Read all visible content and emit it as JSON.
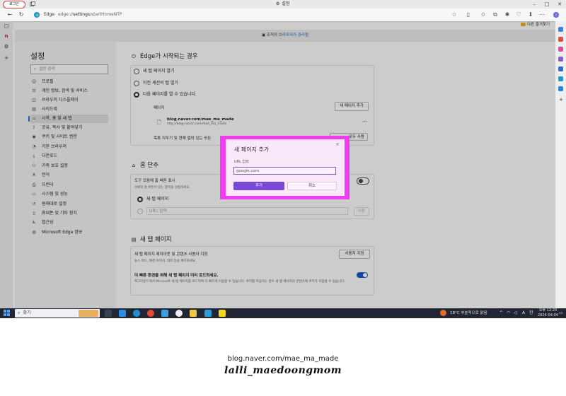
{
  "tabbar": {
    "profile_label": "로그인",
    "tab_title": "설정"
  },
  "addressbar": {
    "edge_label": "Edge",
    "url_prefix": "edge://",
    "url_highlight": "settings",
    "url_suffix": "/startHomeNTP"
  },
  "favorites": {
    "folder_label": "다른 즐겨찾기"
  },
  "banner": {
    "text": "조직의",
    "link": "브라우저가 관리됨"
  },
  "sidebar": {
    "title": "설정",
    "search_placeholder": "설정 검색",
    "items": [
      {
        "label": "프로필",
        "icon": "profile-icon"
      },
      {
        "label": "개인 정보, 검색 및 서비스",
        "icon": "lock-icon"
      },
      {
        "label": "브라우저 디스플레이",
        "icon": "display-icon"
      },
      {
        "label": "사이드바",
        "icon": "sidebar-icon"
      },
      {
        "label": "시작, 홈 및 새 탭",
        "icon": "home-icon"
      },
      {
        "label": "공유, 복사 및 붙여넣기",
        "icon": "share-icon"
      },
      {
        "label": "쿠키 및 사이트 권한",
        "icon": "cookie-icon"
      },
      {
        "label": "기본 브라우저",
        "icon": "browser-icon"
      },
      {
        "label": "다운로드",
        "icon": "download-icon"
      },
      {
        "label": "가족 보호 설정",
        "icon": "family-icon"
      },
      {
        "label": "언어",
        "icon": "language-icon"
      },
      {
        "label": "프린터",
        "icon": "printer-icon"
      },
      {
        "label": "시스템 및 성능",
        "icon": "system-icon"
      },
      {
        "label": "원래대로 설정",
        "icon": "reset-icon"
      },
      {
        "label": "휴대폰 및 기타 장치",
        "icon": "phone-icon"
      },
      {
        "label": "접근성",
        "icon": "accessibility-icon"
      },
      {
        "label": "Microsoft Edge 정보",
        "icon": "edge-icon"
      }
    ],
    "active_index": 4
  },
  "startup": {
    "heading": "Edge가 시작되는 경우",
    "options": [
      "새 탭 페이지 열기",
      "이전 세션의 탭 열기",
      "다음 페이지를 열 수 있습니다."
    ],
    "selected_index": 2,
    "pages_label": "페이지",
    "add_page_button": "새 페이지 추가",
    "page_title": "blog.naver.com/mae_ma_made",
    "page_url": "http://blog.naver.com/mae_ma_made",
    "more_icon": "...",
    "clear_text": "목록 지우기 및 현재 열려 있는 모든",
    "use_all_button": "모두 사용"
  },
  "home": {
    "heading": "홈 단추",
    "toolbar_title": "도구 모음에 홈 버튼 표시",
    "toolbar_desc": "이렇게 홈 버튼이 있는 항목을 설정하세요.",
    "toolbar_toggle_on": false,
    "options": [
      "새 탭 페이지",
      "URL 입력"
    ],
    "selected_index": 0,
    "save_button": "저장"
  },
  "newtab": {
    "heading": "새 탭 페이지",
    "customize_title": "새 탭 페이지 레이아웃 및 콘텐츠 사용자 지정",
    "customize_desc": "뉴스 피드, 배경 이미지, 테마 등을 제어하세요.",
    "customize_button": "사용자 지정",
    "preload_title": "더 빠른 환경을 위해 새 탭 페이지 미리 로드하세요.",
    "preload_desc": "백그라운드에서 Microsoft 새 탭 페이지를 로드하여 더 빠르게 이용할 수 있습니다. 쿠키를 허용하는 경우 새 탭 페이지의 콘텐츠에 쿠키가 포함될 수 있습니다.",
    "preload_toggle_on": true
  },
  "dialog": {
    "title": "새 페이지 추가",
    "close_icon": "×",
    "url_label": "URL 입력",
    "url_value": "google.com",
    "add_button": "추가",
    "cancel_button": "취소"
  },
  "taskbar": {
    "search_label": "찾기",
    "weather": "18°C 부분적으로 맑음",
    "tray_lang": "A",
    "tray_ime": "한",
    "time": "오후 12:20",
    "date": "2024-04-04"
  },
  "footer": {
    "url": "blog.naver.com/mae_ma_made",
    "signature": "lalli_maedoongmom"
  },
  "colors": {
    "accent": "#7848d6",
    "highlight": "#f23cf2",
    "toggle_on": "#1a56c8",
    "taskbar": "#202634"
  }
}
